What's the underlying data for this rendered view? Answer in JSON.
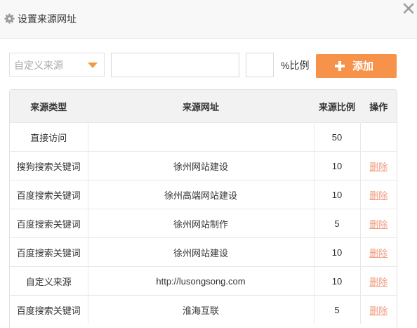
{
  "dialog": {
    "title": "设置来源网址",
    "icons": {
      "settings": "gear-icon",
      "close": "close-icon"
    }
  },
  "form": {
    "source_type_select": {
      "value": "自定义来源"
    },
    "url_input": {
      "value": "",
      "placeholder": ""
    },
    "ratio_input": {
      "value": "",
      "placeholder": ""
    },
    "ratio_label": "%比例",
    "add_button_label": "添加"
  },
  "table": {
    "headers": [
      "来源类型",
      "来源网址",
      "来源比例",
      "操作"
    ],
    "rows": [
      {
        "type": "直接访问",
        "url": "",
        "ratio": "50",
        "action": ""
      },
      {
        "type": "搜狗搜索关键词",
        "url": "徐州网站建设",
        "ratio": "10",
        "action": "删除"
      },
      {
        "type": "百度搜索关键词",
        "url": "徐州高端网站建设",
        "ratio": "10",
        "action": "删除"
      },
      {
        "type": "百度搜索关键词",
        "url": "徐州网站制作",
        "ratio": "5",
        "action": "删除"
      },
      {
        "type": "百度搜索关键词",
        "url": "徐州网站建设",
        "ratio": "10",
        "action": "删除"
      },
      {
        "type": "自定义来源",
        "url": "http://lusongsong.com",
        "ratio": "10",
        "action": "删除"
      },
      {
        "type": "百度搜索关键词",
        "url": "淮海互联",
        "ratio": "5",
        "action": "删除"
      }
    ]
  },
  "colors": {
    "accent": "#f7924b",
    "dropdown_arrow": "#f39a3d",
    "delete_link": "#f0997b",
    "header_bg": "#f8f8f8",
    "table_header_bg": "#f2f2f2"
  }
}
